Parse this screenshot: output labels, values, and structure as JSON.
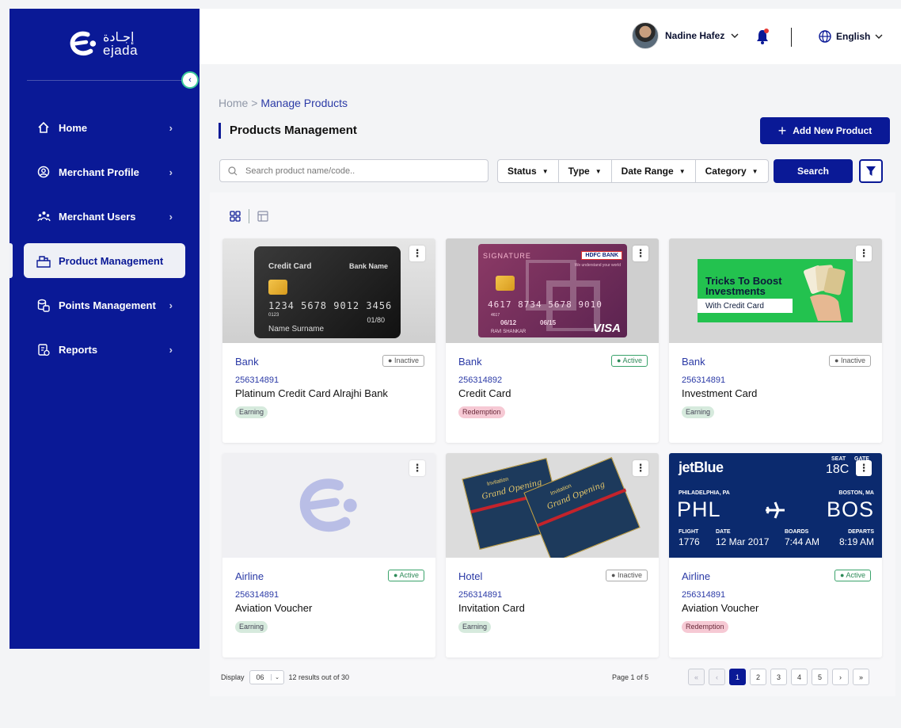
{
  "brand": {
    "name_ar": "إجـادة",
    "name_en": "ejada"
  },
  "sidebar": {
    "items": [
      {
        "label": "Home",
        "icon": "home-icon"
      },
      {
        "label": "Merchant Profile",
        "icon": "user-circle-icon"
      },
      {
        "label": "Merchant Users",
        "icon": "users-icon"
      },
      {
        "label": "Product Management",
        "icon": "box-icon",
        "active": true
      },
      {
        "label": "Points Management",
        "icon": "coins-icon"
      },
      {
        "label": "Reports",
        "icon": "report-icon"
      }
    ]
  },
  "topbar": {
    "user_name": "Nadine Hafez",
    "language": "English"
  },
  "breadcrumb": {
    "home": "Home",
    "separator": " > ",
    "current": "Manage Products"
  },
  "page_title": "Products Management",
  "add_button": "Add New Product",
  "search": {
    "placeholder": "Search product name/code..",
    "button": "Search"
  },
  "filters": [
    "Status",
    "Type",
    "Date Range",
    "Category"
  ],
  "cards": [
    {
      "category": "Bank",
      "status": "Inactive",
      "code": "256314891",
      "name": "Platinum Credit Card Alrajhi Bank",
      "type": "Earning"
    },
    {
      "category": "Bank",
      "status": "Active",
      "code": "256314892",
      "name": "Credit Card",
      "type": "Redemption"
    },
    {
      "category": "Bank",
      "status": "Inactive",
      "code": "256314891",
      "name": "Investment Card",
      "type": "Earning"
    },
    {
      "category": "Airline",
      "status": "Active",
      "code": "256314891",
      "name": "Aviation Voucher",
      "type": "Earning"
    },
    {
      "category": "Hotel",
      "status": "Inactive",
      "code": "256314891",
      "name": "Invitation Card",
      "type": "Earning"
    },
    {
      "category": "Airline",
      "status": "Active",
      "code": "256314891",
      "name": "Aviation Voucher",
      "type": "Redemption"
    }
  ],
  "card_art": {
    "cc1": {
      "title": "Credit Card",
      "bank": "Bank Name",
      "number": "1234  5678  9012  3456",
      "small": "0123",
      "expiry": "01/80",
      "holder": "Name Surname"
    },
    "hdfc": {
      "brand": "SIGNATURE",
      "bank": "HDFC BANK",
      "tagline": "We understand your world",
      "number": "4617  8734  5678  9010",
      "small": "4617",
      "valid_from": "06/12",
      "valid_thru": "06/15",
      "holder": "RAVI SHANKAR",
      "network": "VISA"
    },
    "invest": {
      "line1": "Tricks To Boost",
      "line2": "Investments",
      "line3": "With Credit Card"
    },
    "invite": {
      "label": "Invitation",
      "script": "Grand Opening"
    },
    "jetblue": {
      "airline": "jetBlue",
      "seat_label": "SEAT",
      "gate_label": "GATE",
      "seat": "18C",
      "from_city": "PHILADELPHIA, PA",
      "to_city": "BOSTON, MA",
      "from": "PHL",
      "to": "BOS",
      "flight_label": "FLIGHT",
      "flight": "1776",
      "date_label": "DATE",
      "date": "12 Mar 2017",
      "boards_label": "BOARDS",
      "boards": "7:44 AM",
      "departs_label": "DEPARTS",
      "departs": "8:19 AM"
    }
  },
  "footer": {
    "display_label": "Display",
    "display_value": "06",
    "results": "12 results out of  30",
    "page_label": "Page",
    "page_current": "1",
    "page_of": "of",
    "page_total": "5",
    "pages": [
      "1",
      "2",
      "3",
      "4",
      "5"
    ]
  },
  "colors": {
    "primary": "#0a1996",
    "active_green": "#3aa36b",
    "earning_bg": "#d6eadd",
    "redemption_bg": "#f6c9d4",
    "accent_teal": "#3ac89a",
    "notification_red": "#e53935"
  }
}
